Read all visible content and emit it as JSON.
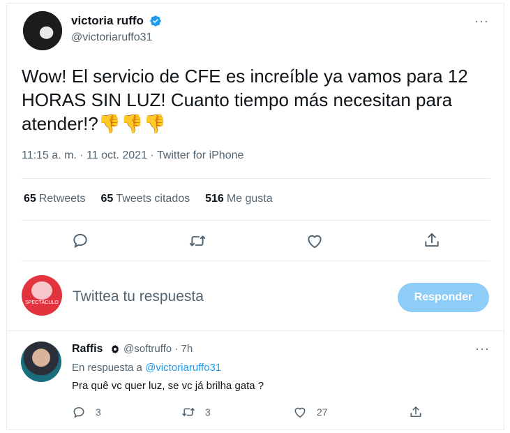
{
  "tweet": {
    "author_name": "victoria ruffo",
    "author_handle": "@victoriaruffo31",
    "more": "···",
    "text": "Wow! El servicio de CFE es increíble ya vamos para 12 HORAS SIN LUZ! Cuanto tiempo más necesitan para atender!?👎👎👎",
    "time": "11:15 a. m. · 11 oct. 2021 · Twitter for iPhone",
    "stats": {
      "retweets_count": "65",
      "retweets_label": "Retweets",
      "quotes_count": "65",
      "quotes_label": "Tweets citados",
      "likes_count": "516",
      "likes_label": "Me gusta"
    }
  },
  "reply_box": {
    "placeholder": "Twittea tu respuesta",
    "button_label": "Responder",
    "avatar_text": "SPECTÁCULO"
  },
  "reply": {
    "author_name": "Raffis",
    "author_handle": "@softruffo · 7h",
    "replying_prefix": "En respuesta a",
    "replying_to": "@victoriaruffo31",
    "text": "Pra quê vc quer luz,  se vc já brilha gata ?",
    "more": "···",
    "reply_count": "3",
    "retweet_count": "3",
    "like_count": "27"
  },
  "colors": {
    "accent": "#1d9bf0",
    "button_disabled": "#8ecdf8",
    "secondary_text": "#536471",
    "divider": "#e6ecf0"
  }
}
